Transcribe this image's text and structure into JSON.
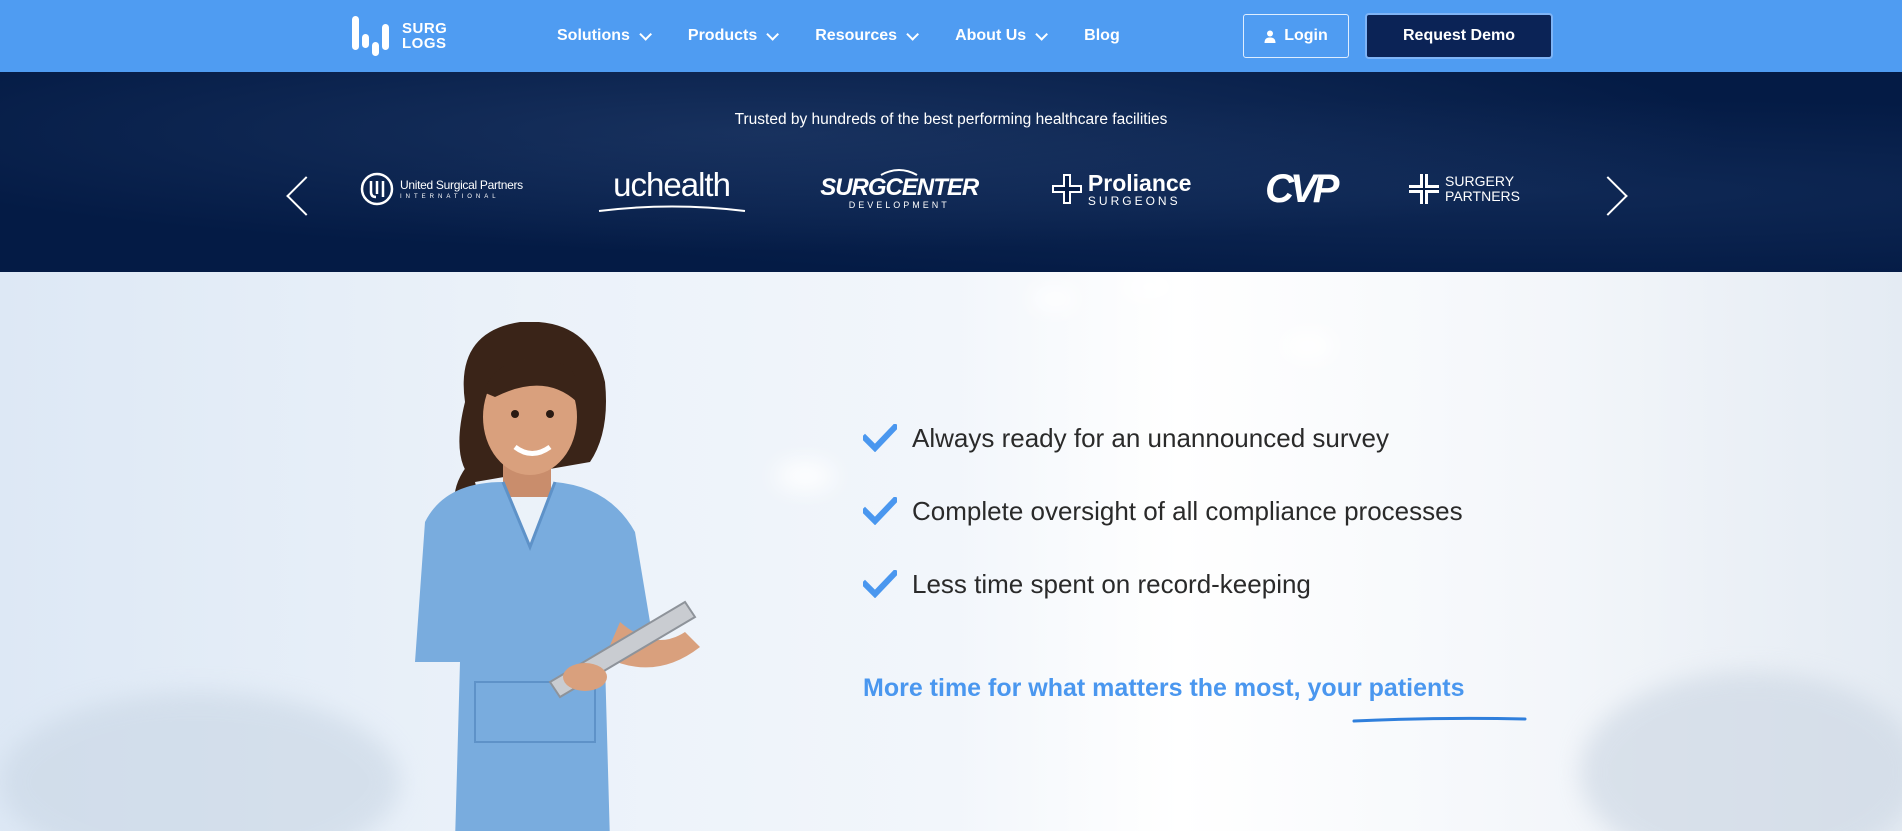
{
  "nav": {
    "logo_line1": "SURG",
    "logo_line2": "LOGS",
    "items": [
      {
        "label": "Solutions"
      },
      {
        "label": "Products"
      },
      {
        "label": "Resources"
      },
      {
        "label": "About Us"
      },
      {
        "label": "Blog"
      }
    ],
    "login_label": "Login",
    "demo_label": "Request Demo"
  },
  "trust": {
    "title": "Trusted by hundreds of the best performing healthcare facilities",
    "logos": [
      {
        "name": "United Surgical Partners",
        "sub": "INTERNATIONAL"
      },
      {
        "name": "uchealth"
      },
      {
        "name": "SURGCENTER",
        "sub": "DEVELOPMENT"
      },
      {
        "name": "Proliance",
        "sub": "SURGEONS"
      },
      {
        "name": "CVP"
      },
      {
        "name": "SURGERY",
        "sub": "PARTNERS"
      }
    ]
  },
  "hero": {
    "benefits": [
      "Always ready for an unannounced survey",
      "Complete oversight of all compliance processes",
      "Less time spent on record-keeping"
    ],
    "tagline": "More time for what matters the most, your patients"
  },
  "colors": {
    "nav_bg": "#4f9cf2",
    "trust_bg": "#041b45",
    "accent": "#4a97ef",
    "demo_bg": "#0b2356"
  }
}
